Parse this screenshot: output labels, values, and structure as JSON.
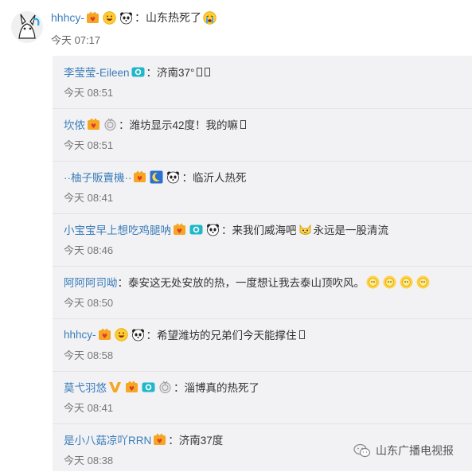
{
  "post": {
    "username": "hhhcy-",
    "separator": "：",
    "text": "山东热死了",
    "time": "今天 07:17",
    "icons": [
      "vip-badge-icon",
      "grin-emoji-icon",
      "panda-icon",
      "crying-emoji-icon"
    ]
  },
  "comments": [
    {
      "username": "李莹莹-Eileen",
      "text": "济南37°",
      "tofu_count": 2,
      "time": "今天 08:51",
      "icons": [
        "camera-badge-icon"
      ]
    },
    {
      "username": "坎侬",
      "text": "潍坊显示42度！我的嘛",
      "tofu_count": 1,
      "time": "今天 08:51",
      "icons": [
        "vip-badge-icon",
        "medal-badge-icon"
      ]
    },
    {
      "username": "··柚子販賣機··",
      "text": "临沂人热死",
      "tofu_count": 0,
      "time": "今天 08:41",
      "icons": [
        "vip-badge-icon",
        "moon-badge-icon",
        "panda-icon"
      ]
    },
    {
      "username": "小宝宝早上想吃鸡腿呐",
      "text": "来我们威海吧",
      "text2": "永远是一股清流",
      "tofu_count": 0,
      "time": "今天 08:46",
      "icons": [
        "vip-badge-icon",
        "camera-badge-icon",
        "panda-icon"
      ]
    },
    {
      "username": "阿阿阿司呦",
      "text": "泰安这无处安放的热，一度想让我去泰山顶吹风。",
      "tofu_count": 0,
      "time": "今天 08:50",
      "icons": []
    },
    {
      "username": "hhhcy-",
      "text": "希望潍坊的兄弟们今天能撑住",
      "tofu_count": 1,
      "time": "今天 08:58",
      "icons": [
        "vip-badge-icon",
        "grin-emoji-icon",
        "panda-icon"
      ]
    },
    {
      "username": "莫弋羽悠",
      "text": "淄博真的热死了",
      "tofu_count": 0,
      "time": "今天 08:41",
      "icons": [
        "v-verified-icon",
        "vip-badge-icon",
        "camera-badge-icon",
        "medal-badge-icon"
      ]
    },
    {
      "username": "是小八菇凉吖RRN",
      "text": "济南37度",
      "tofu_count": 0,
      "time": "今天 08:38",
      "icons": [
        "vip-badge-icon"
      ]
    }
  ],
  "watermark": {
    "text": "山东广播电视报",
    "icon": "wechat-logo-icon"
  },
  "colors": {
    "username": "#3a7cb8",
    "comment_bg": "#f2f2f5",
    "vip_orange": "#f5a623",
    "time": "#777777"
  }
}
